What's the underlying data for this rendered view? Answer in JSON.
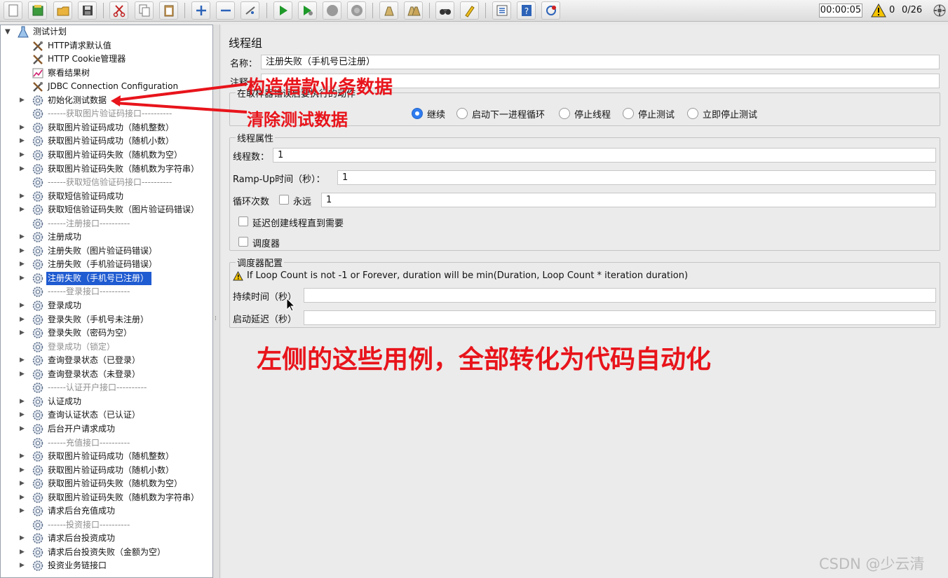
{
  "toolbar": {
    "buttons": [
      {
        "name": "new-icon"
      },
      {
        "name": "templates-icon"
      },
      {
        "name": "open-icon"
      },
      {
        "name": "save-icon"
      },
      {
        "name": "cut-icon"
      },
      {
        "name": "copy-icon"
      },
      {
        "name": "paste-icon"
      },
      {
        "name": "expand-icon"
      },
      {
        "name": "collapse-icon"
      },
      {
        "name": "toggle-icon"
      },
      {
        "name": "start-icon"
      },
      {
        "name": "start-no-pause-icon"
      },
      {
        "name": "stop-icon"
      },
      {
        "name": "shutdown-icon"
      },
      {
        "name": "clear-icon"
      },
      {
        "name": "clear-all-icon"
      },
      {
        "name": "search-icon"
      },
      {
        "name": "reset-search-icon"
      },
      {
        "name": "function-helper-icon"
      },
      {
        "name": "help-icon"
      },
      {
        "name": "remote-icon"
      }
    ],
    "timer": "00:00:05",
    "warning_count": "0",
    "thread_count": "0/26"
  },
  "tree": {
    "root": "测试计划",
    "items": [
      {
        "label": "HTTP请求默认值",
        "icon": "config-icon",
        "disabled": false
      },
      {
        "label": "HTTP Cookie管理器",
        "icon": "config-icon",
        "disabled": false
      },
      {
        "label": "察看结果树",
        "icon": "listener-icon",
        "disabled": false
      },
      {
        "label": "JDBC Connection Configuration",
        "icon": "config-icon",
        "disabled": false
      },
      {
        "label": "初始化测试数据",
        "icon": "gear-icon",
        "disabled": false
      },
      {
        "label": "------获取图片验证码接口----------",
        "icon": "gear-icon",
        "disabled": true
      },
      {
        "label": "获取图片验证码成功（随机整数）",
        "icon": "gear-icon",
        "disabled": false
      },
      {
        "label": "获取图片验证码成功（随机小数）",
        "icon": "gear-icon",
        "disabled": false
      },
      {
        "label": "获取图片验证码失败（随机数为空）",
        "icon": "gear-icon",
        "disabled": false
      },
      {
        "label": "获取图片验证码失败（随机数为字符串）",
        "icon": "gear-icon",
        "disabled": false
      },
      {
        "label": "------获取短信验证码接口----------",
        "icon": "gear-icon",
        "disabled": true
      },
      {
        "label": "获取短信验证码成功",
        "icon": "gear-icon",
        "disabled": false
      },
      {
        "label": "获取短信验证码失败（图片验证码错误）",
        "icon": "gear-icon",
        "disabled": false
      },
      {
        "label": "------注册接口----------",
        "icon": "gear-icon",
        "disabled": true
      },
      {
        "label": "注册成功",
        "icon": "gear-icon",
        "disabled": false
      },
      {
        "label": "注册失败（图片验证码错误）",
        "icon": "gear-icon",
        "disabled": false
      },
      {
        "label": "注册失败（手机验证码错误）",
        "icon": "gear-icon",
        "disabled": false
      },
      {
        "label": "注册失败（手机号已注册）",
        "icon": "gear-icon",
        "disabled": false,
        "selected": true
      },
      {
        "label": "------登录接口----------",
        "icon": "gear-icon",
        "disabled": true
      },
      {
        "label": "登录成功",
        "icon": "gear-icon",
        "disabled": false
      },
      {
        "label": "登录失败（手机号未注册）",
        "icon": "gear-icon",
        "disabled": false
      },
      {
        "label": "登录失败（密码为空）",
        "icon": "gear-icon",
        "disabled": false
      },
      {
        "label": "登录成功（锁定）",
        "icon": "gear-icon",
        "disabled": true
      },
      {
        "label": "查询登录状态（已登录）",
        "icon": "gear-icon",
        "disabled": false
      },
      {
        "label": "查询登录状态（未登录）",
        "icon": "gear-icon",
        "disabled": false
      },
      {
        "label": "------认证开户接口----------",
        "icon": "gear-icon",
        "disabled": true
      },
      {
        "label": "认证成功",
        "icon": "gear-icon",
        "disabled": false
      },
      {
        "label": "查询认证状态（已认证）",
        "icon": "gear-icon",
        "disabled": false
      },
      {
        "label": "后台开户请求成功",
        "icon": "gear-icon",
        "disabled": false
      },
      {
        "label": "------充值接口----------",
        "icon": "gear-icon",
        "disabled": true
      },
      {
        "label": "获取图片验证码成功（随机整数）",
        "icon": "gear-icon",
        "disabled": false
      },
      {
        "label": "获取图片验证码成功（随机小数）",
        "icon": "gear-icon",
        "disabled": false
      },
      {
        "label": "获取图片验证码失败（随机数为空）",
        "icon": "gear-icon",
        "disabled": false
      },
      {
        "label": "获取图片验证码失败（随机数为字符串）",
        "icon": "gear-icon",
        "disabled": false
      },
      {
        "label": "请求后台充值成功",
        "icon": "gear-icon",
        "disabled": false
      },
      {
        "label": "------投资接口----------",
        "icon": "gear-icon",
        "disabled": true
      },
      {
        "label": "请求后台投资成功",
        "icon": "gear-icon",
        "disabled": false
      },
      {
        "label": "请求后台投资失败（金额为空）",
        "icon": "gear-icon",
        "disabled": false
      },
      {
        "label": "投资业务链接口",
        "icon": "gear-icon",
        "disabled": false
      }
    ]
  },
  "panel": {
    "title": "线程组",
    "name_label": "名称：",
    "name_value": "注册失败（手机号已注册）",
    "comment_label": "注释：",
    "comment_value": "",
    "error_action_title": "在取样器错误后要执行的动作",
    "error_actions": [
      {
        "label": "继续",
        "selected": true
      },
      {
        "label": "启动下一进程循环",
        "selected": false
      },
      {
        "label": "停止线程",
        "selected": false
      },
      {
        "label": "停止测试",
        "selected": false
      },
      {
        "label": "立即停止测试",
        "selected": false
      }
    ],
    "thread_props_title": "线程属性",
    "threads_label": "线程数：",
    "threads_value": "1",
    "rampup_label": "Ramp-Up时间（秒）：",
    "rampup_value": "1",
    "loop_label": "循环次数",
    "forever_label": "永远",
    "forever_checked": false,
    "loop_value": "1",
    "delay_label": "延迟创建线程直到需要",
    "delay_checked": false,
    "scheduler_label": "调度器",
    "scheduler_checked": false,
    "scheduler_config_title": "调度器配置",
    "scheduler_warning": "If Loop Count is not -1 or Forever, duration will be min(Duration, Loop Count * iteration duration)",
    "duration_label": "持续时间（秒）",
    "duration_value": "",
    "startup_delay_label": "启动延迟（秒）",
    "startup_delay_value": ""
  },
  "annotations": {
    "build_data": "构造借款业务数据",
    "clear_data": "清除测试数据",
    "summary": "左侧的这些用例，全部转化为代码自动化",
    "color": "#e8141b"
  },
  "watermark": "CSDN @少云清"
}
